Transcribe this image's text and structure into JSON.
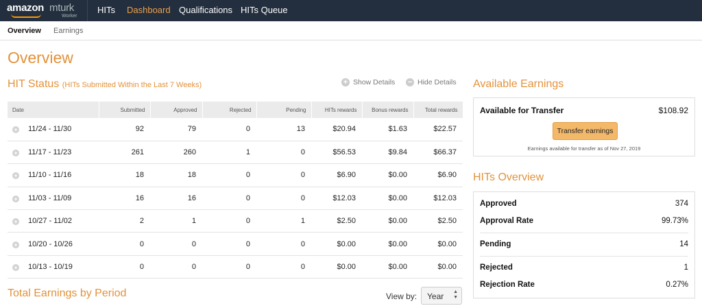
{
  "brand": {
    "name": "amazon",
    "product": "mturk",
    "sub": "Worker"
  },
  "nav": {
    "hits": "HITs",
    "dashboard": "Dashboard",
    "qualifications": "Qualifications",
    "queue": "HITs Queue"
  },
  "subnav": {
    "overview": "Overview",
    "earnings": "Earnings"
  },
  "page_title": "Overview",
  "hit_status": {
    "title": "HIT Status",
    "subtitle": "(HITs Submitted Within the Last 7 Weeks)",
    "show_details": "Show Details",
    "hide_details": "Hide Details",
    "columns": [
      "Date",
      "Submitted",
      "Approved",
      "Rejected",
      "Pending",
      "HITs rewards",
      "Bonus rewards",
      "Total rewards"
    ],
    "rows": [
      [
        "11/24 - 11/30",
        "92",
        "79",
        "0",
        "13",
        "$20.94",
        "$1.63",
        "$22.57"
      ],
      [
        "11/17 - 11/23",
        "261",
        "260",
        "1",
        "0",
        "$56.53",
        "$9.84",
        "$66.37"
      ],
      [
        "11/10 - 11/16",
        "18",
        "18",
        "0",
        "0",
        "$6.90",
        "$0.00",
        "$6.90"
      ],
      [
        "11/03 - 11/09",
        "16",
        "16",
        "0",
        "0",
        "$12.03",
        "$0.00",
        "$12.03"
      ],
      [
        "10/27 - 11/02",
        "2",
        "1",
        "0",
        "1",
        "$2.50",
        "$0.00",
        "$2.50"
      ],
      [
        "10/20 - 10/26",
        "0",
        "0",
        "0",
        "0",
        "$0.00",
        "$0.00",
        "$0.00"
      ],
      [
        "10/13 - 10/19",
        "0",
        "0",
        "0",
        "0",
        "$0.00",
        "$0.00",
        "$0.00"
      ]
    ]
  },
  "total_earnings": {
    "title": "Total Earnings by Period",
    "view_by_label": "View by:",
    "view_by_value": "Year"
  },
  "available_earnings": {
    "title": "Available Earnings",
    "label": "Available for Transfer",
    "amount": "$108.92",
    "button": "Transfer earnings",
    "note": "Earnings available for transfer as of Nov 27, 2019"
  },
  "hits_overview": {
    "title": "HITs Overview",
    "rows": [
      {
        "label": "Approved",
        "value": "374"
      },
      {
        "label": "Approval Rate",
        "value": "99.73%"
      },
      {
        "label": "Pending",
        "value": "14"
      },
      {
        "label": "Rejected",
        "value": "1"
      },
      {
        "label": "Rejection Rate",
        "value": "0.27%"
      }
    ]
  },
  "colors": {
    "nav_bg": "#232f3e",
    "accent": "#e3923a",
    "button": "#f4b869"
  }
}
